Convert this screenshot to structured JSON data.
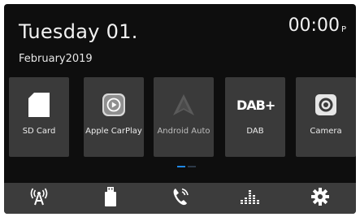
{
  "status": {
    "date_line1": "Tuesday 01.",
    "date_line2": "February2019",
    "time": "00:00",
    "time_suffix": "P"
  },
  "apps": [
    {
      "label": "SD Card",
      "icon": "sd-card-icon"
    },
    {
      "label": "Apple CarPlay",
      "icon": "carplay-icon"
    },
    {
      "label": "Android Auto",
      "icon": "android-auto-icon"
    },
    {
      "label": "DAB",
      "icon": "dab-icon"
    },
    {
      "label": "Camera",
      "icon": "camera-icon"
    }
  ],
  "dab_logo_text": "DAB+",
  "page_indicator": {
    "current": 1,
    "total": 2
  },
  "bottom_nav": [
    {
      "icon": "radio-antenna-icon"
    },
    {
      "icon": "usb-drive-icon"
    },
    {
      "icon": "phone-icon"
    },
    {
      "icon": "equalizer-icon"
    },
    {
      "icon": "settings-gear-icon"
    }
  ],
  "colors": {
    "background": "#0e0e0e",
    "tile": "#3a3a3a",
    "bottom_bar": "#3c3c3c",
    "accent": "#1e88e5"
  }
}
